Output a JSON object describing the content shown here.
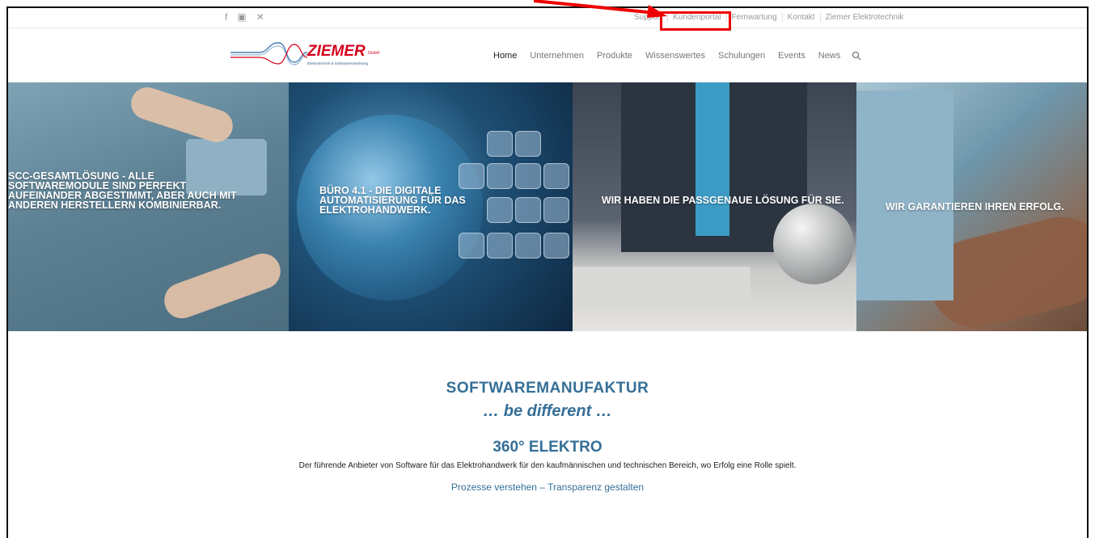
{
  "topbar": {
    "social_icons": [
      "facebook-icon",
      "youtube-icon",
      "xing-icon"
    ],
    "links": [
      "Support",
      "Kundenportal",
      "Fernwartung",
      "Kontakt",
      "Ziemer Elektrotechnik"
    ]
  },
  "header": {
    "logo_text": "ZIEMER",
    "logo_suffix": "GmbH",
    "logo_tagline": "Elektrotechnik & Softwareentwicklung",
    "nav": [
      "Home",
      "Unternehmen",
      "Produkte",
      "Wissenswertes",
      "Schulungen",
      "Events",
      "News"
    ],
    "active": "Home"
  },
  "hero": {
    "panels": [
      "SCC-GESAMTLÖSUNG - ALLE SOFTWAREMODULE SIND PERFEKT AUFEINANDER ABGESTIMMT, ABER AUCH MIT ANDEREN HERSTELLERN KOMBINIERBAR.",
      "BÜRO 4.1 - DIE DIGITALE AUTOMATISIERUNG FÜR DAS ELEKTROHANDWERK.",
      "WIR HABEN DIE PASSGENAUE LÖSUNG FÜR SIE.",
      "WIR GARANTIEREN IHREN ERFOLG."
    ]
  },
  "intro": {
    "heading": "SOFTWAREMANUFAKTUR",
    "tagline": "… be different …",
    "subheading": "360° ELEKTRO",
    "description": "Der führende Anbieter von Software für das Elektrohandwerk für den kaufmännischen und technischen Bereich, wo Erfolg eine Rolle spielt.",
    "subline": "Prozesse verstehen – Transparenz gestalten"
  },
  "colors": {
    "accent": "#356f97",
    "annotation": "#e00000",
    "logo_red": "#d6001c"
  }
}
